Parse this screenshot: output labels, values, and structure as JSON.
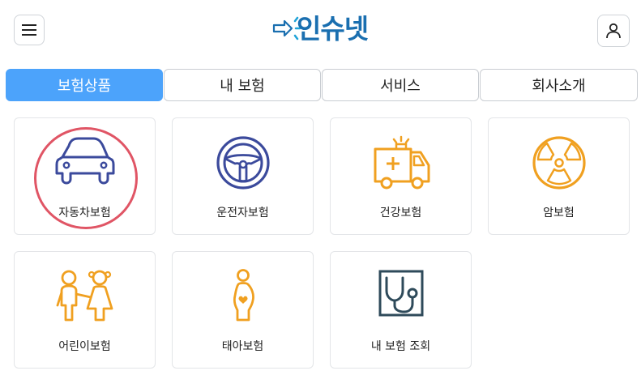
{
  "header": {
    "menu_icon": "hamburger-menu-icon",
    "logo_text": "인슈넷",
    "logo_color": "#1a6fb0",
    "user_icon": "user-icon"
  },
  "tabs": [
    {
      "label": "보험상품",
      "active": true
    },
    {
      "label": "내 보험",
      "active": false
    },
    {
      "label": "서비스",
      "active": false
    },
    {
      "label": "회사소개",
      "active": false
    }
  ],
  "accent_color": "#4ca3fb",
  "products": [
    {
      "label": "자동차보험",
      "icon": "car-icon",
      "highlighted": true
    },
    {
      "label": "운전자보험",
      "icon": "steering-wheel-icon"
    },
    {
      "label": "건강보험",
      "icon": "ambulance-icon"
    },
    {
      "label": "암보험",
      "icon": "radiation-icon"
    },
    {
      "label": "어린이보험",
      "icon": "children-icon"
    },
    {
      "label": "태아보험",
      "icon": "pregnant-woman-icon"
    },
    {
      "label": "내 보험 조회",
      "icon": "stethoscope-icon"
    }
  ]
}
